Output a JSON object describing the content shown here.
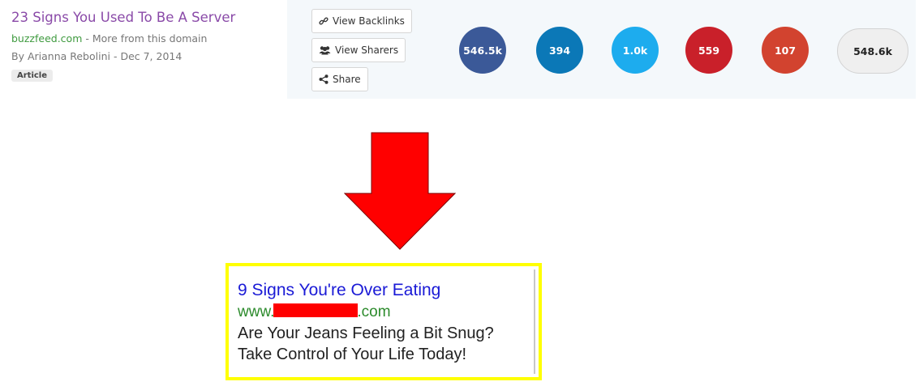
{
  "result": {
    "title": "23 Signs You Used To Be A Server",
    "domain": "buzzfeed.com",
    "more_from_domain": " - More from this domain",
    "byline": "By Arianna Rebolini - Dec 7, 2014",
    "badge": "Article"
  },
  "actions": {
    "backlinks_label": "View Backlinks",
    "sharers_label": "View Sharers",
    "share_label": "Share"
  },
  "shares": {
    "facebook": "546.5k",
    "linkedin": "394",
    "twitter": "1.0k",
    "pinterest": "559",
    "googleplus": "107",
    "total": "548.6k"
  },
  "colors": {
    "facebook": "#3b5998",
    "linkedin": "#0b78b7",
    "twitter": "#1dacee",
    "pinterest": "#c9202a",
    "googleplus": "#d2432f",
    "arrow": "#ff0000",
    "ad_border": "#ffff00",
    "redaction": "#ff0000"
  },
  "ad": {
    "headline": "9 Signs You're Over Eating",
    "url_prefix": "www.",
    "url_suffix": ".com",
    "line1": "Are Your Jeans Feeling a Bit Snug?",
    "line2": "Take Control of Your Life Today!"
  }
}
